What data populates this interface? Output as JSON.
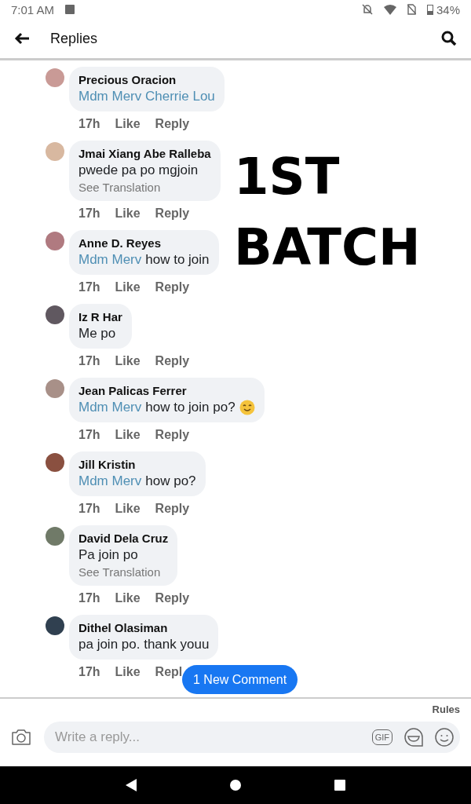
{
  "status_bar": {
    "time": "7:01 AM",
    "battery": "34%"
  },
  "header": {
    "title": "Replies"
  },
  "comments": [
    {
      "name": "Precious Oracion",
      "mention": "Mdm Merv Cherrie Lou",
      "time": "17h",
      "like": "Like",
      "reply": "Reply"
    },
    {
      "name": "Jmai Xiang Abe Ralleba",
      "text": "pwede pa po mgjoin",
      "translation": "See Translation",
      "time": "17h",
      "like": "Like",
      "reply": "Reply"
    },
    {
      "name": "Anne D. Reyes",
      "mention": "Mdm Merv",
      "text": "how to join",
      "time": "17h",
      "like": "Like",
      "reply": "Reply"
    },
    {
      "name": "Iz R Har",
      "text": "Me po",
      "time": "17h",
      "like": "Like",
      "reply": "Reply"
    },
    {
      "name": "Jean Palicas Ferrer",
      "mention": "Mdm Merv",
      "text": "how to join po?",
      "emoji": true,
      "time": "17h",
      "like": "Like",
      "reply": "Reply"
    },
    {
      "name": "Jill Kristin",
      "mention": "Mdm Merv",
      "text": "how po?",
      "time": "17h",
      "like": "Like",
      "reply": "Reply"
    },
    {
      "name": "David Dela Cruz",
      "text": "Pa join po",
      "translation": "See Translation",
      "time": "17h",
      "like": "Like",
      "reply": "Reply"
    },
    {
      "name": "Dithel Olasiman",
      "text": "pa join po. thank youu",
      "time": "17h",
      "like": "Like",
      "reply": "Repl"
    }
  ],
  "new_comment_badge": "1 New Comment",
  "overlay_text": [
    "1ST",
    "BATCH"
  ],
  "composer": {
    "rules": "Rules",
    "placeholder": "Write a reply...",
    "gif": "GIF"
  }
}
